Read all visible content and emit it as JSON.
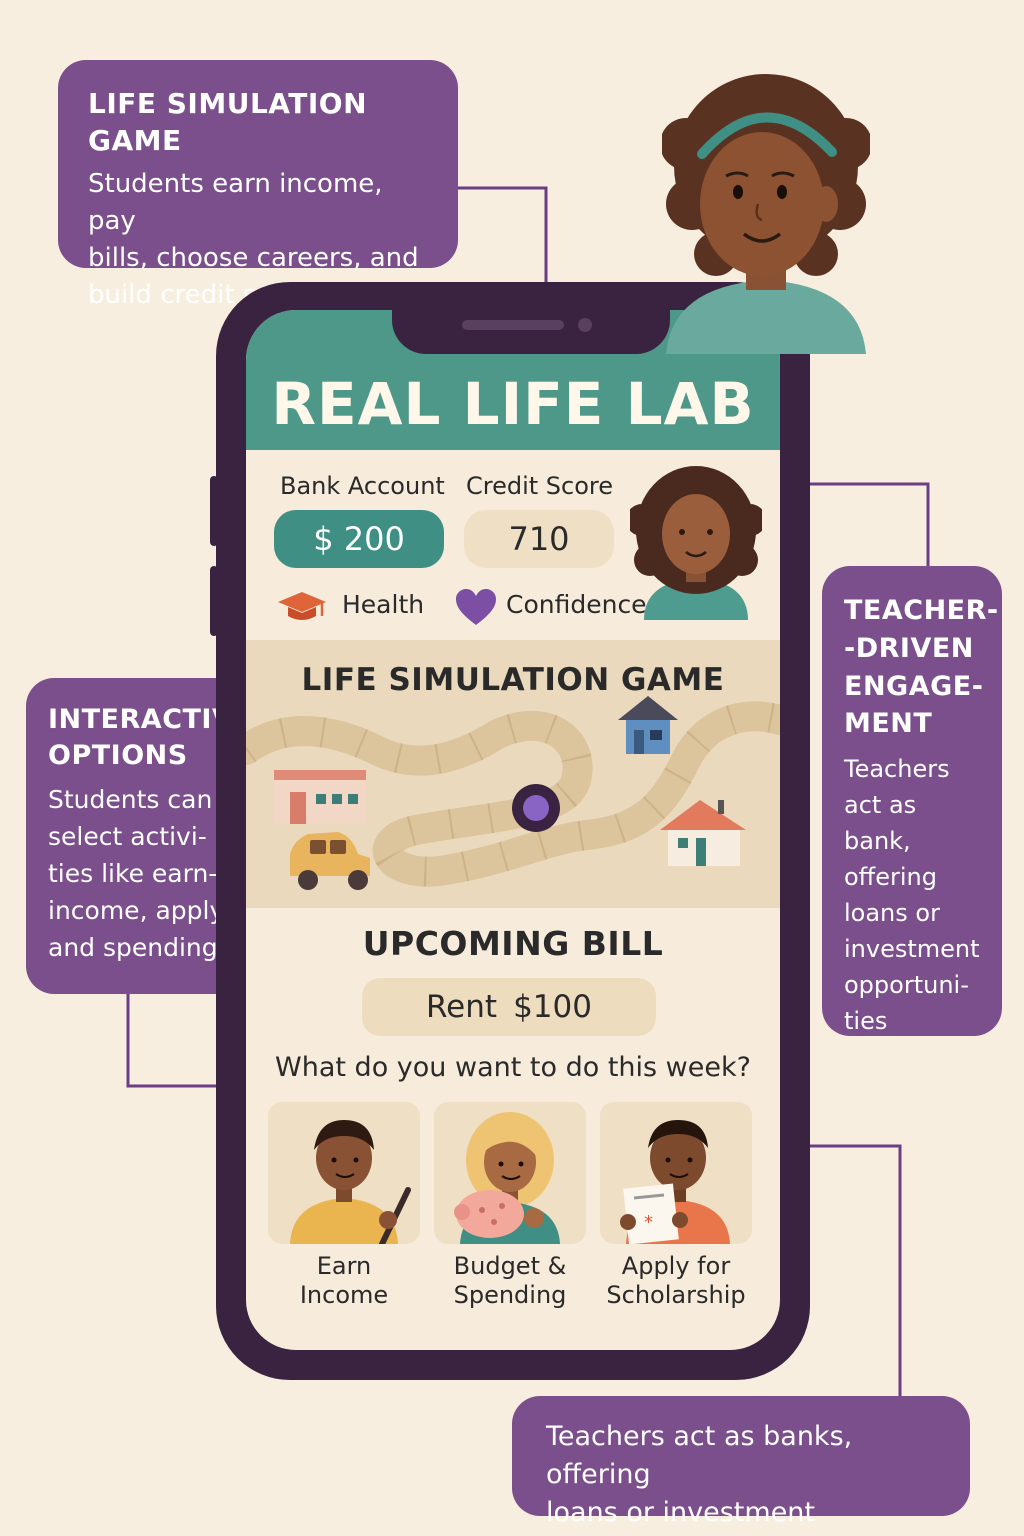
{
  "callouts": {
    "life_sim": {
      "title": "LIFE SIMULATION GAME",
      "body": "Students earn income, pay bills, choose careers, and build credit scores."
    },
    "interactive": {
      "title": "INTERACTIVE OPTIONS",
      "body": "Students can select activi-ties like earn-income, apply and spending"
    },
    "teacher": {
      "title": "TEACHER--DRIVEN ENGAGE-MENT",
      "body": "Teachers act as bank, offering loans or investment opportuni-ties"
    },
    "banks": {
      "body": "Teachers act as banks, offering loans or investment"
    }
  },
  "app": {
    "title": "REAL LIFE LAB",
    "bank_account_label": "Bank Account",
    "bank_account_value": "$ 200",
    "credit_score_label": "Credit Score",
    "credit_score_value": "710",
    "health_label": "Health",
    "confidence_label": "Confidence",
    "map_title": "LIFE SIMULATION GAME",
    "bill_title": "UPCOMING BILL",
    "bill_name": "Rent",
    "bill_amount": "$100",
    "question": "What do you want to do this week?",
    "options": [
      {
        "line1": "Earn",
        "line2": "Income"
      },
      {
        "line1": "Budget &",
        "line2": "Spending"
      },
      {
        "line1": "Apply for",
        "line2": "Scholarship"
      }
    ]
  },
  "colors": {
    "background": "#f8eedf",
    "callout": "#7b4e8c",
    "phone": "#3a2340",
    "header_teal": "#4e988a",
    "bank_pill": "#3f8f84",
    "accent_purple": "#6a3d86"
  },
  "icons": [
    "graduation-cap-icon",
    "heart-icon",
    "house-icon",
    "car-icon",
    "store-icon",
    "game-token-icon",
    "piggy-bank-icon",
    "certificate-icon"
  ]
}
